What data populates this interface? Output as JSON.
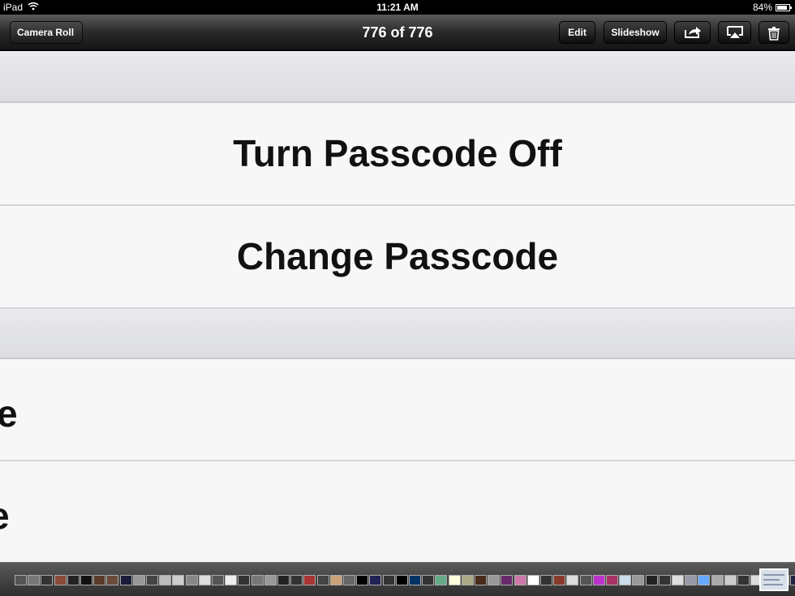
{
  "status": {
    "device": "iPad",
    "time": "11:21 AM",
    "battery": "84%",
    "battery_level": 0.84
  },
  "nav": {
    "back_label": "Camera Roll",
    "title": "776 of 776",
    "edit_label": "Edit",
    "slideshow_label": "Slideshow",
    "share_icon": "share-icon",
    "airplay_icon": "airplay-icon",
    "trash_icon": "trash-icon"
  },
  "photo": {
    "rows": [
      "Turn Passcode Off",
      "Change Passcode",
      "e",
      "e"
    ]
  },
  "filmstrip": {
    "thumb_colors": [
      "#555",
      "#777",
      "#333",
      "#8a4b3a",
      "#222",
      "#111",
      "#5a3a2a",
      "#6a4b3a",
      "#1a1a3a",
      "#999",
      "#444",
      "#bbb",
      "#ccc",
      "#888",
      "#ddd",
      "#555",
      "#eee",
      "#333",
      "#777",
      "#999",
      "#222",
      "#333",
      "#a33",
      "#444",
      "#c9a27a",
      "#666",
      "#000",
      "#225",
      "#333",
      "#000",
      "#036",
      "#333",
      "#6a8",
      "#ffd",
      "#aa8",
      "#4a2a1a",
      "#999",
      "#6a2a6a",
      "#c7a",
      "#fff",
      "#333",
      "#8a3a2a",
      "#ddd",
      "#555",
      "#b3c",
      "#a36",
      "#cde",
      "#999",
      "#222",
      "#333",
      "#ddd",
      "#99a",
      "#6af",
      "#aaa",
      "#ccc",
      "#333",
      "#ddd",
      "#bbb",
      "#666",
      "#224",
      "#cdf",
      "#111",
      "#888",
      "#999",
      "#ddd",
      "#444",
      "#555",
      "#ccc",
      "#aaa",
      "#334",
      "#aac",
      "#bbb"
    ]
  }
}
